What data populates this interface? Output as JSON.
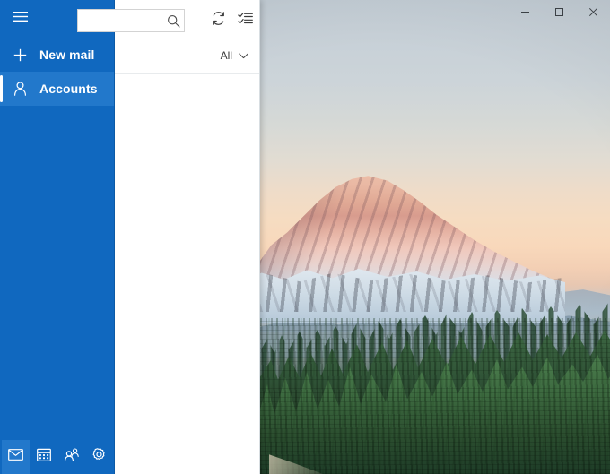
{
  "window": {
    "controls": [
      {
        "name": "minimize",
        "label": "─",
        "tooltip": "Minimize"
      },
      {
        "name": "maximize",
        "label": "□",
        "tooltip": "Maximize"
      },
      {
        "name": "close",
        "label": "×",
        "tooltip": "Close"
      }
    ]
  },
  "nav": {
    "menu_icon": "hamburger-icon",
    "items": [
      {
        "label": "New mail",
        "icon": "plus-icon",
        "selected": false
      },
      {
        "label": "Accounts",
        "icon": "person-icon",
        "selected": true
      }
    ],
    "app_buttons": [
      {
        "label": "Mail",
        "icon": "envelope-icon",
        "active": true
      },
      {
        "label": "Calendar",
        "icon": "calendar-icon",
        "active": false
      },
      {
        "label": "People",
        "icon": "people-icon",
        "active": false
      },
      {
        "label": "Settings",
        "icon": "gear-icon",
        "active": false
      }
    ]
  },
  "toolbar": {
    "search": {
      "value": "",
      "placeholder": ""
    },
    "search_icon": "magnifier-icon",
    "sync_label": "Sync this view",
    "sync_icon": "refresh-icon",
    "selection_label": "Enter selection mode",
    "selection_icon": "checklist-icon"
  },
  "filter": {
    "label": "All",
    "chevron_icon": "chevron-down-icon"
  },
  "message_list": {
    "items": []
  },
  "colors": {
    "nav_blue": "#1068bf",
    "nav_selected_blue": "#2278cb",
    "nav_border": "#0c5aa6",
    "pane_background": "#ffffff",
    "divider": "#e8ebed",
    "search_border": "#d3d3d3"
  },
  "wallpaper": {
    "description": "Mount Rainier at sunset with evergreen forest",
    "sky_top": "#c2ccd4",
    "sky_warm": "#f6dcc1",
    "alpenglow": "#f0c3ad",
    "forest": "#2f5236"
  }
}
